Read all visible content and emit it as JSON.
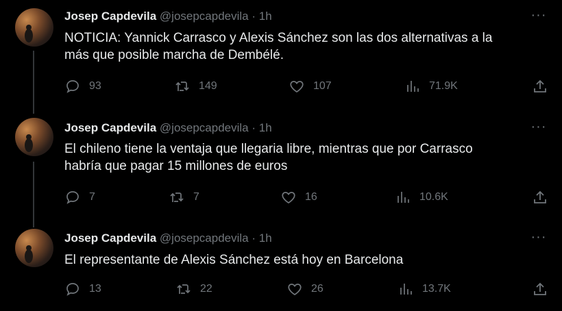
{
  "tweets": [
    {
      "name": "Josep Capdevila",
      "handle": "@josepcapdevila",
      "sep": "·",
      "time": "1h",
      "text_lines": [
        "NOTICIA: Yannick Carrasco y Alexis Sánchez son las dos alternativas a la",
        "más que posible marcha de Dembélé."
      ],
      "replies": "93",
      "retweets": "149",
      "likes": "107",
      "views": "71.9K"
    },
    {
      "name": "Josep Capdevila",
      "handle": "@josepcapdevila",
      "sep": "·",
      "time": "1h",
      "text_lines": [
        "El chileno tiene la ventaja que llegaria libre, mientras que por Carrasco",
        "habría que pagar 15 millones de euros"
      ],
      "replies": "7",
      "retweets": "7",
      "likes": "16",
      "views": "10.6K"
    },
    {
      "name": "Josep Capdevila",
      "handle": "@josepcapdevila",
      "sep": "·",
      "time": "1h",
      "text_lines": [
        "El representante de Alexis Sánchez está hoy en Barcelona"
      ],
      "replies": "13",
      "retweets": "22",
      "likes": "26",
      "views": "13.7K"
    }
  ],
  "icons": {
    "reply": "reply-icon",
    "retweet": "retweet-icon",
    "like": "heart-icon",
    "views": "views-chart-icon",
    "share": "share-icon",
    "more": "more-dots-icon"
  },
  "colors": {
    "background": "#000000",
    "text": "#e7e9ea",
    "muted": "#71767b",
    "thread_line": "#333639"
  }
}
